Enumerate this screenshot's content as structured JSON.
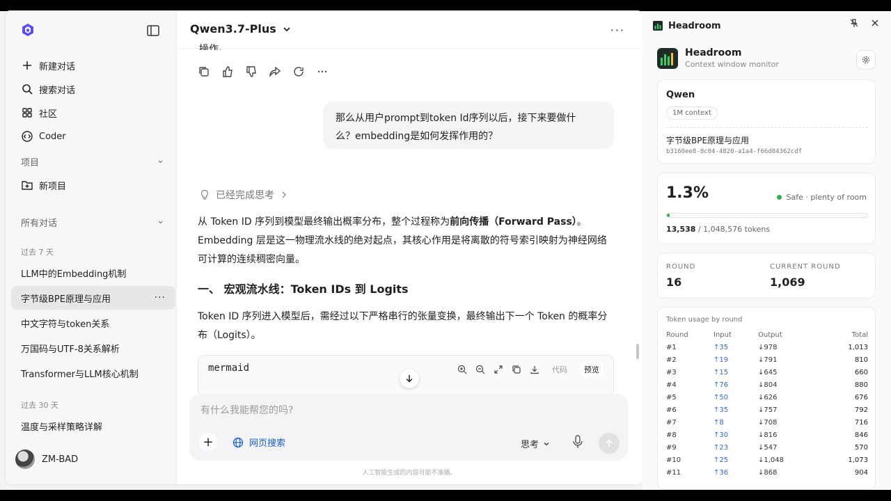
{
  "sidebar": {
    "new_chat": "新建对话",
    "search_chat": "搜索对话",
    "community": "社区",
    "coder": "Coder",
    "projects_label": "项目",
    "new_project": "新项目",
    "all_chats_label": "所有对话",
    "group_7days": "过去 7 天",
    "group_30days": "过去 30 天",
    "conversations_7": [
      "LLM中的Embedding机制",
      "字节级BPE原理与应用",
      "中文字符与token关系",
      "万国码与UTF-8关系解析",
      "Transformer与LLM核心机制"
    ],
    "conversations_30": [
      "温度与采样策略详解"
    ],
    "active_more": "···",
    "user_name": "ZM-BAD"
  },
  "main": {
    "model": "Qwen3.7-Plus",
    "top_more": "···",
    "clipped_text": "操作。",
    "user_message_line1": "那么从用户prompt到token Id序列以后，接下来要做什",
    "user_message_line2": "么？embedding是如何发挥作用的？",
    "thinking_done": "已经完成思考",
    "para1_a": "从 Token ID 序列到模型最终输出概率分布，整个过程称为",
    "para1_bold": "前向传播（Forward Pass）",
    "para1_b": "。Embedding 层是这一物理流水线的绝对起点，其核心作用是将离散的符号索引映射为神经网络可计算的连续稠密向量。",
    "heading": "一、 宏观流水线：Token IDs 到 Logits",
    "para2": "Token ID 序列进入模型后，需经过以下严格串行的张量变换，最终输出下一个 Token 的概率分布（Logits）。",
    "code_lang": "mermaid",
    "code_tab_code": "代码",
    "code_tab_preview": "预览",
    "composer_placeholder": "有什么我能帮您的吗?",
    "web_search": "网页搜索",
    "think_mode": "思考",
    "disclaimer": "人工智能生成的内容可能不准确。"
  },
  "panel": {
    "title": "Headroom",
    "brand_title": "Headroom",
    "brand_sub": "Context window monitor",
    "model_name": "Qwen",
    "context_badge": "1M context",
    "conv_title": "字节级BPE原理与应用",
    "conv_id": "b3160ee8-8c04-4820-a1a4-f66d84362cdf",
    "usage_pct": "1.3%",
    "usage_fraction": 0.013,
    "safe_text": "Safe · plenty of room",
    "tokens_used": "13,538",
    "tokens_total": "/ 1,048,576 tokens",
    "round_label": "ROUND",
    "round_value": "16",
    "current_round_label": "CURRENT ROUND",
    "current_round_value": "1,069",
    "usage_title": "Token usage by round",
    "table_headers": [
      "Round",
      "Input",
      "Output",
      "Total"
    ],
    "rows": [
      {
        "round": "#1",
        "input": "↑35",
        "output": "↓978",
        "total": "1,013"
      },
      {
        "round": "#2",
        "input": "↑19",
        "output": "↓791",
        "total": "810"
      },
      {
        "round": "#3",
        "input": "↑15",
        "output": "↓645",
        "total": "660"
      },
      {
        "round": "#4",
        "input": "↑76",
        "output": "↓804",
        "total": "880"
      },
      {
        "round": "#5",
        "input": "↑50",
        "output": "↓626",
        "total": "676"
      },
      {
        "round": "#6",
        "input": "↑35",
        "output": "↓757",
        "total": "792"
      },
      {
        "round": "#7",
        "input": "↑8",
        "output": "↓708",
        "total": "716"
      },
      {
        "round": "#8",
        "input": "↑30",
        "output": "↓816",
        "total": "846"
      },
      {
        "round": "#9",
        "input": "↑23",
        "output": "↓547",
        "total": "570"
      },
      {
        "round": "#10",
        "input": "↑25",
        "output": "↓1,048",
        "total": "1,073"
      },
      {
        "round": "#11",
        "input": "↑36",
        "output": "↓868",
        "total": "904"
      }
    ],
    "colors": {
      "safe": "#2fb34f",
      "input": "#3366cc"
    }
  }
}
